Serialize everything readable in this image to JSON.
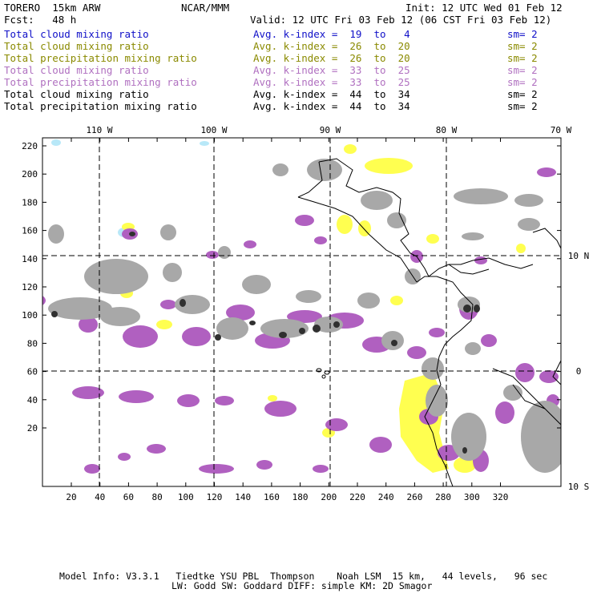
{
  "header": {
    "model": "TORERO  15km ARW",
    "org": "NCAR/MMM",
    "init": "Init: 12 UTC Wed 01 Feb 12",
    "fcst": "Fcst:   48 h",
    "valid": "Valid: 12 UTC Fri 03 Feb 12 (06 CST Fri 03 Feb 12)"
  },
  "legend": [
    {
      "name": "Total cloud mixing ratio",
      "avg": "Avg. k-index =  19  to   4",
      "sm": "sm= 2",
      "color": "#1010c8"
    },
    {
      "name": "Total cloud mixing ratio",
      "avg": "Avg. k-index =  26  to  20",
      "sm": "sm= 2",
      "color": "#8a8a00"
    },
    {
      "name": "Total precipitation mixing ratio",
      "avg": "Avg. k-index =  26  to  20",
      "sm": "sm= 2",
      "color": "#8a8a00"
    },
    {
      "name": "Total cloud mixing ratio",
      "avg": "Avg. k-index =  33  to  25",
      "sm": "sm= 2",
      "color": "#b070c0"
    },
    {
      "name": "Total precipitation mixing ratio",
      "avg": "Avg. k-index =  33  to  25",
      "sm": "sm= 2",
      "color": "#b070c0"
    },
    {
      "name": "Total cloud mixing ratio",
      "avg": "Avg. k-index =  44  to  34",
      "sm": "sm= 2",
      "color": "#000000"
    },
    {
      "name": "Total precipitation mixing ratio",
      "avg": "Avg. k-index =  44  to  34",
      "sm": "sm= 2",
      "color": "#000000"
    }
  ],
  "map": {
    "top_axis": [
      "110 W",
      "100 W",
      "90 W",
      "80 W",
      "70 W"
    ],
    "right_axis": [
      "10 N",
      "0",
      "10 S"
    ],
    "left_axis": [
      "220",
      "200",
      "180",
      "160",
      "140",
      "120",
      "100",
      "80",
      "60",
      "40",
      "20"
    ],
    "bottom_axis": [
      "20",
      "40",
      "60",
      "80",
      "100",
      "120",
      "140",
      "160",
      "180",
      "200",
      "220",
      "240",
      "260",
      "280",
      "300",
      "320"
    ],
    "colors": {
      "gray": "#a8a8a8",
      "dark": "#303030",
      "magenta": "#b060c0",
      "yellow": "#ffff50",
      "lightblue": "#b8e8f8"
    }
  },
  "footer": {
    "line1": "Model Info: V3.3.1   Tiedtke YSU PBL  Thompson    Noah LSM  15 km,   44 levels,   96 sec",
    "line2": "LW: Godd SW: Goddard DIFF: simple KM: 2D Smagor"
  }
}
